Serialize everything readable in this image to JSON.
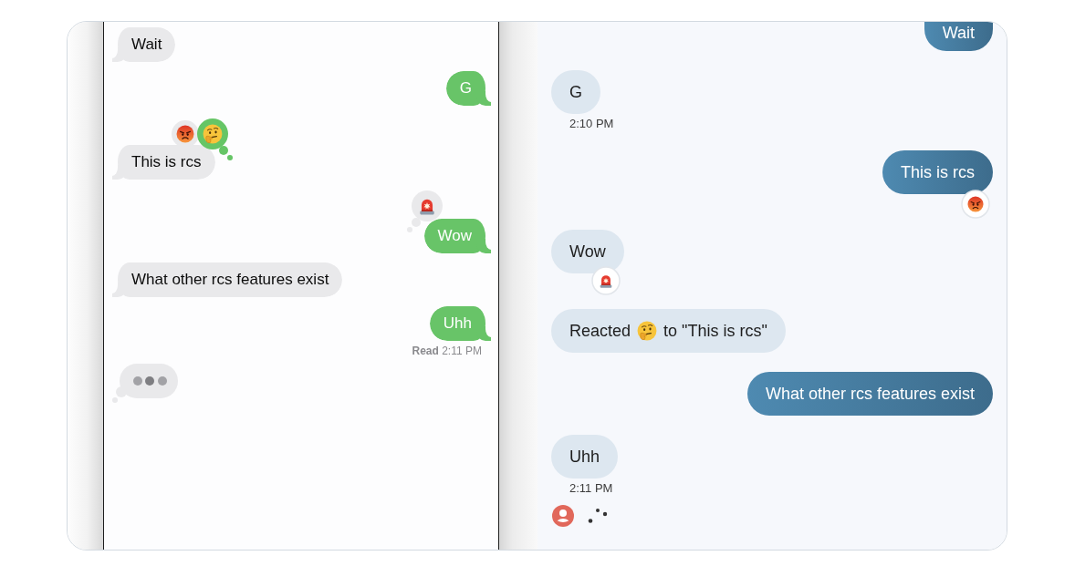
{
  "imessage": {
    "messages": [
      {
        "kind": "received",
        "text": "Wait"
      },
      {
        "kind": "sent",
        "text": "G"
      },
      {
        "kind": "received",
        "text": "This is rcs",
        "reactions": [
          {
            "kind": "angry",
            "own": false
          },
          {
            "kind": "thinking",
            "own": true
          }
        ]
      },
      {
        "kind": "sent",
        "text": "Wow",
        "reactions": [
          {
            "kind": "siren",
            "own": false
          }
        ]
      },
      {
        "kind": "received",
        "text": "What other rcs features exist"
      },
      {
        "kind": "sent",
        "text": "Uhh",
        "receipt": "**Read** 2:11 PM"
      },
      {
        "kind": "typing"
      }
    ]
  },
  "google_messages": {
    "messages": [
      {
        "kind": "sent",
        "text": "Wait"
      },
      {
        "kind": "received",
        "text": "G",
        "time": "2:10 PM"
      },
      {
        "kind": "sent",
        "text": "This is rcs",
        "reactions": [
          {
            "kind": "angry"
          }
        ]
      },
      {
        "kind": "received",
        "text": "Wow",
        "reactions": [
          {
            "kind": "siren"
          }
        ]
      },
      {
        "kind": "reaction_notice",
        "text": "Reacted",
        "reaction": {
          "kind": "thinking"
        },
        "text_after": "to \"This is rcs\""
      },
      {
        "kind": "sent",
        "text": "What other rcs features exist"
      },
      {
        "kind": "received",
        "text": "Uhh",
        "time": "2:11 PM"
      },
      {
        "kind": "typing"
      }
    ]
  }
}
